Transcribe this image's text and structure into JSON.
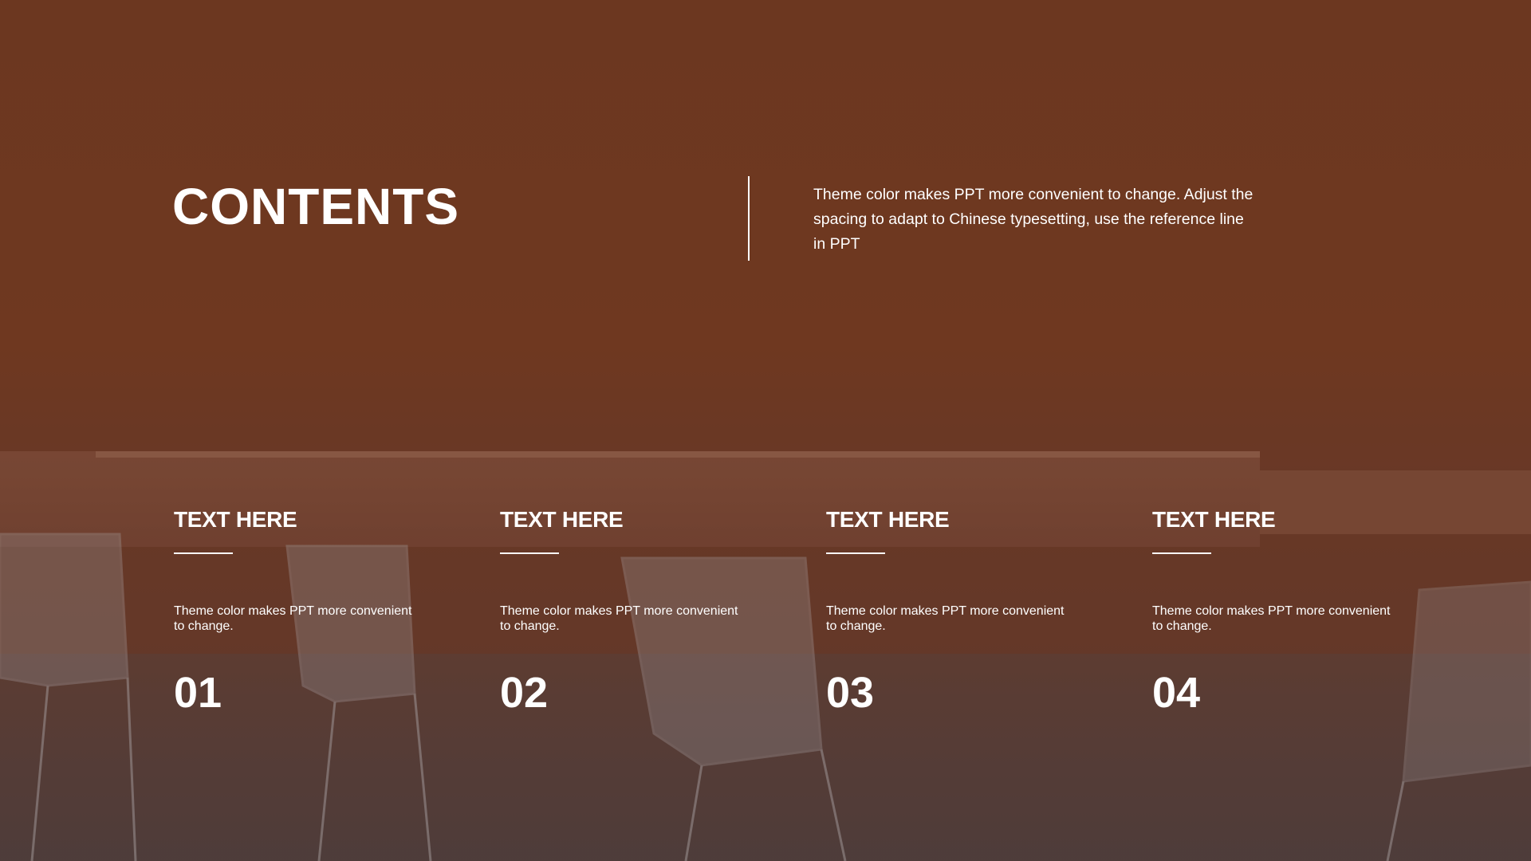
{
  "slide": {
    "title": "CONTENTS",
    "intro": "Theme color makes PPT more convenient to change. Adjust the spacing to adapt to Chinese typesetting, use the reference line in PPT",
    "colors": {
      "background": "#6e3922",
      "text": "#ffffff"
    },
    "items": [
      {
        "heading": "TEXT HERE",
        "description": "Theme color makes PPT more convenient to change.",
        "number": "01"
      },
      {
        "heading": "TEXT HERE",
        "description": "Theme color makes PPT more convenient to change.",
        "number": "02"
      },
      {
        "heading": "TEXT HERE",
        "description": "Theme color makes PPT more convenient to change.",
        "number": "03"
      },
      {
        "heading": "TEXT HERE",
        "description": "Theme color makes PPT more convenient to change.",
        "number": "04"
      }
    ]
  }
}
